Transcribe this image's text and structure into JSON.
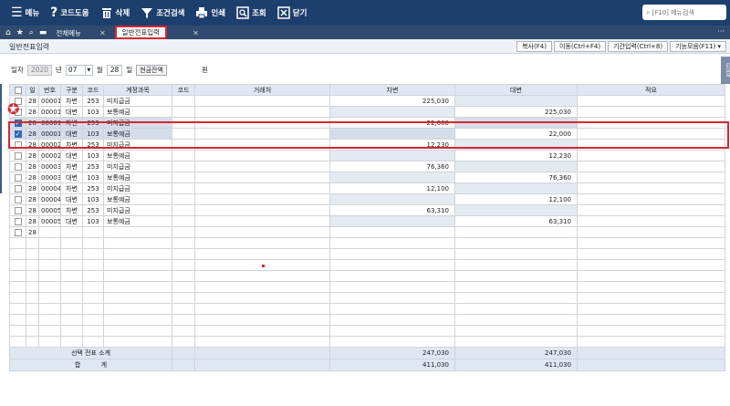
{
  "toolbar": {
    "buttons": [
      {
        "icon": "menu-icon",
        "label": "메뉴"
      },
      {
        "icon": "help-icon",
        "label": "코드도움"
      },
      {
        "icon": "trash-icon",
        "label": "삭제"
      },
      {
        "icon": "filter-icon",
        "label": "조건검색"
      },
      {
        "icon": "print-icon",
        "label": "인쇄"
      },
      {
        "icon": "search-icon",
        "label": "조회"
      },
      {
        "icon": "close-icon",
        "label": "닫기"
      }
    ],
    "search_placeholder": "[F10] 메뉴검색"
  },
  "tabs": {
    "items": [
      {
        "label": "전체메뉴",
        "active": false
      },
      {
        "label": "일반전표입력",
        "active": true
      }
    ]
  },
  "title": {
    "text": "일반전표입력",
    "buttons": [
      "복사(F4)",
      "이동(Ctrl+F4)",
      "기간입력(Ctrl+8)",
      "기능모음(F11)"
    ],
    "guide": "GUIDE"
  },
  "filter": {
    "date_label": "일자",
    "year": "2020",
    "year_unit": "년",
    "month": "07",
    "month_unit": "월",
    "day": "28",
    "day_unit": "일",
    "cash_button": "현금잔액",
    "won_unit": "원"
  },
  "grid": {
    "headers": [
      "",
      "일",
      "번호",
      "구분",
      "코드",
      "계정과목",
      "코드",
      "거래처",
      "차변",
      "대변",
      "적요"
    ],
    "rows": [
      {
        "checked": false,
        "day": "28",
        "no": "00001",
        "type": "차변",
        "code": "253",
        "account": "미지급금",
        "debit": "225,030",
        "credit": ""
      },
      {
        "checked": false,
        "day": "28",
        "no": "00001",
        "type": "대변",
        "code": "103",
        "account": "보통예금",
        "debit": "",
        "credit": "225,030"
      },
      {
        "checked": true,
        "day": "28",
        "no": "00001",
        "type": "차변",
        "code": "253",
        "account": "미지급금",
        "debit": "22,000",
        "credit": ""
      },
      {
        "checked": true,
        "day": "28",
        "no": "00001",
        "type": "대변",
        "code": "103",
        "account": "보통예금",
        "debit": "",
        "credit": "22,000"
      },
      {
        "checked": false,
        "day": "28",
        "no": "00002",
        "type": "차변",
        "code": "253",
        "account": "미지급금",
        "debit": "12,230",
        "credit": ""
      },
      {
        "checked": false,
        "day": "28",
        "no": "00002",
        "type": "대변",
        "code": "103",
        "account": "보통예금",
        "debit": "",
        "credit": "12,230"
      },
      {
        "checked": false,
        "day": "28",
        "no": "00003",
        "type": "차변",
        "code": "253",
        "account": "미지급금",
        "debit": "76,360",
        "credit": ""
      },
      {
        "checked": false,
        "day": "28",
        "no": "00003",
        "type": "대변",
        "code": "103",
        "account": "보통예금",
        "debit": "",
        "credit": "76,360"
      },
      {
        "checked": false,
        "day": "28",
        "no": "00004",
        "type": "차변",
        "code": "253",
        "account": "미지급금",
        "debit": "12,100",
        "credit": ""
      },
      {
        "checked": false,
        "day": "28",
        "no": "00004",
        "type": "대변",
        "code": "103",
        "account": "보통예금",
        "debit": "",
        "credit": "12,100"
      },
      {
        "checked": false,
        "day": "28",
        "no": "00005",
        "type": "차변",
        "code": "253",
        "account": "미지급금",
        "debit": "63,310",
        "credit": ""
      },
      {
        "checked": false,
        "day": "28",
        "no": "00005",
        "type": "대변",
        "code": "103",
        "account": "보통예금",
        "debit": "",
        "credit": "63,310"
      },
      {
        "checked": false,
        "day": "28",
        "no": "",
        "type": "",
        "code": "",
        "account": "",
        "debit": "",
        "credit": ""
      }
    ],
    "subtotal_label": "선택 전표 소계",
    "subtotal_debit": "247,030",
    "subtotal_credit": "247,030",
    "total_label": "합          계",
    "total_debit": "411,030",
    "total_credit": "411,030"
  },
  "colors": {
    "toolbar": "#1d3f6e",
    "highlight": "#d7262e",
    "header": "#dfe7f3"
  }
}
